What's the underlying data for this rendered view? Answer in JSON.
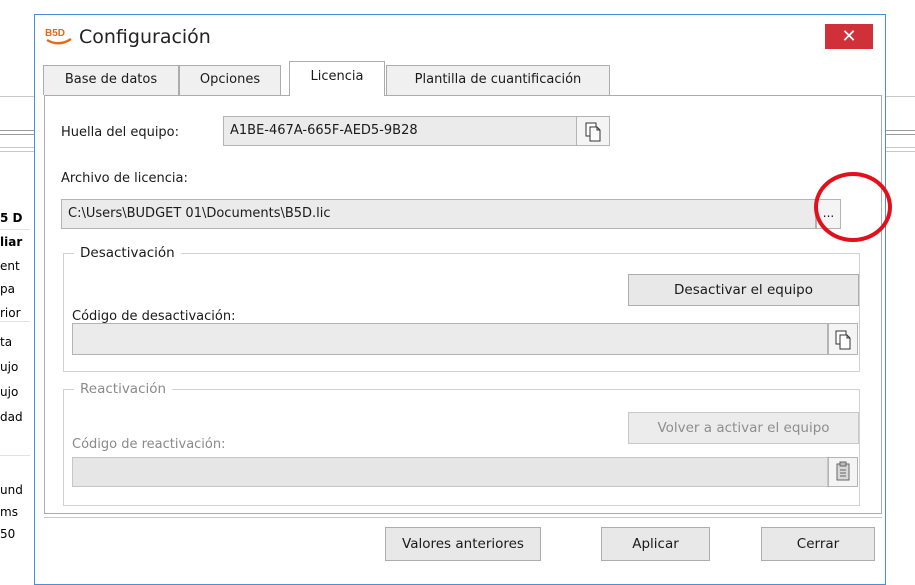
{
  "background": {
    "rows": [
      "5 D",
      "liar",
      "ent",
      "pa",
      "rior",
      "ta",
      "ujo",
      "ujo",
      "dad",
      "und",
      "ms",
      "50"
    ]
  },
  "dialog": {
    "title": "Configuración",
    "logo_text": "B5D",
    "close_symbol": "✕",
    "tabs": [
      {
        "label": "Base de datos",
        "active": false
      },
      {
        "label": "Opciones",
        "active": false
      },
      {
        "label": "Licencia",
        "active": true
      },
      {
        "label": "Plantilla de cuantificación",
        "active": false
      }
    ],
    "license": {
      "fingerprint_label": "Huella del equipo:",
      "fingerprint_value": "A1BE-467A-665F-AED5-9B28",
      "license_file_label": "Archivo de licencia:",
      "license_file_value": "C:\\Users\\BUDGET 01\\Documents\\B5D.lic",
      "browse_label": "...",
      "deactivation": {
        "group_title": "Desactivación",
        "code_label": "Código de desactivación:",
        "button_label": "Desactivar el equipo",
        "code_value": ""
      },
      "reactivation": {
        "group_title": "Reactivación",
        "code_label": "Código de reactivación:",
        "button_label": "Volver a activar el equipo",
        "code_value": "",
        "enabled": false
      }
    },
    "footer": {
      "restore_label": "Valores anteriores",
      "apply_label": "Aplicar",
      "close_label": "Cerrar"
    }
  },
  "colors": {
    "accent_border": "#4a90d9",
    "close_button": "#d0303a",
    "annotation_ring": "#e3101c"
  }
}
